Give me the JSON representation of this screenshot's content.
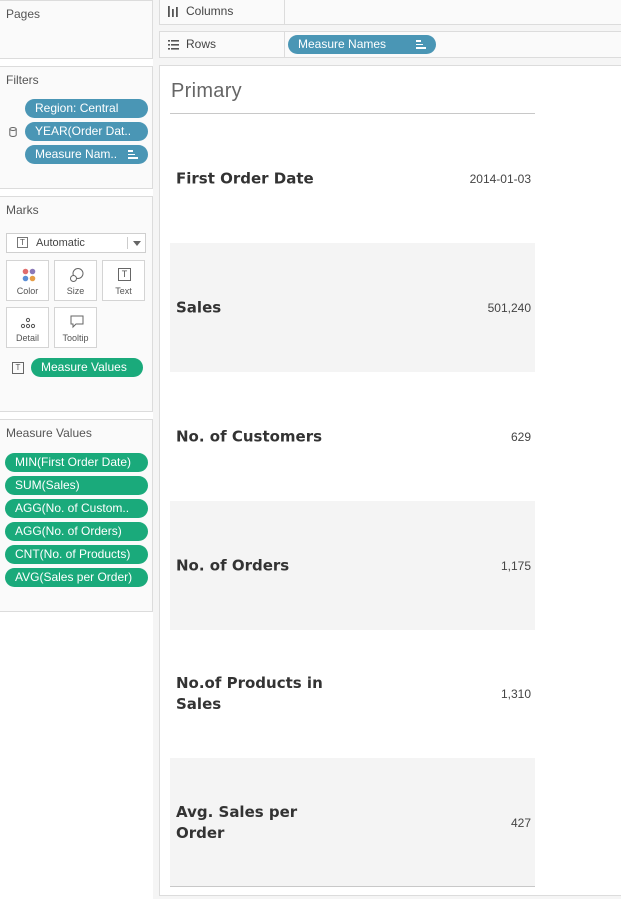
{
  "pages": {
    "title": "Pages"
  },
  "columns_shelf": {
    "label": "Columns"
  },
  "rows_shelf": {
    "label": "Rows",
    "pills": [
      "Measure Names"
    ]
  },
  "filters": {
    "title": "Filters",
    "pills": [
      "Region: Central",
      "YEAR(Order Dat..",
      "Measure Nam.."
    ]
  },
  "marks": {
    "title": "Marks",
    "type_select": "Automatic",
    "buttons": {
      "color": "Color",
      "size": "Size",
      "text": "Text",
      "detail": "Detail",
      "tooltip": "Tooltip"
    },
    "text_pill": "Measure Values"
  },
  "measure_values": {
    "title": "Measure Values",
    "pills": [
      "MIN(First Order Date)",
      "SUM(Sales)",
      "AGG(No. of Custom..",
      "AGG(No. of Orders)",
      "CNT(No. of Products)",
      "AVG(Sales per Order)"
    ]
  },
  "view": {
    "title": "Primary",
    "rows": [
      {
        "name": "First Order Date",
        "value": "2014-01-03"
      },
      {
        "name": "Sales",
        "value": "501,240"
      },
      {
        "name": "No. of Customers",
        "value": "629"
      },
      {
        "name": "No. of Orders",
        "value": "1,175"
      },
      {
        "name": "No.of Products in Sales",
        "value": "1,310"
      },
      {
        "name": "Avg. Sales per Order",
        "value": "427"
      }
    ]
  },
  "colors": {
    "dimension_pill": "#4a96b5",
    "measure_pill": "#1aaa7b",
    "row_shade": "#f4f4f4"
  },
  "icons": [
    "columns-icon",
    "rows-icon",
    "database-icon",
    "sort-icon",
    "text-icon",
    "color-icon",
    "size-icon",
    "detail-icon",
    "tooltip-icon",
    "dropdown-icon"
  ]
}
